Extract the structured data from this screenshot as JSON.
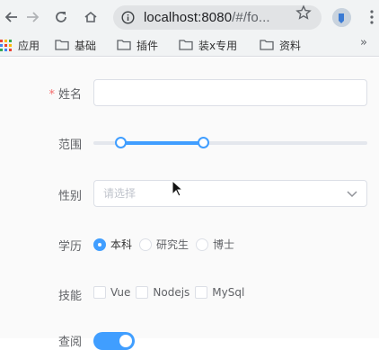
{
  "browser": {
    "url_host": "localhost:8080",
    "url_path": "/#/fo...",
    "bookmarks": [
      {
        "label": "应用",
        "icon": "apps-grid-icon"
      },
      {
        "label": "基础",
        "icon": "folder-icon"
      },
      {
        "label": "插件",
        "icon": "folder-icon"
      },
      {
        "label": "装x专用",
        "icon": "folder-icon"
      },
      {
        "label": "资料",
        "icon": "folder-icon"
      }
    ],
    "more_label": "»"
  },
  "form": {
    "name": {
      "label": "姓名",
      "required_mark": "*",
      "value": ""
    },
    "range": {
      "label": "范围",
      "min_fraction": 0.1,
      "max_fraction": 0.4
    },
    "gender": {
      "label": "性别",
      "placeholder": "请选择"
    },
    "education": {
      "label": "学历",
      "options": [
        "本科",
        "研究生",
        "博士"
      ],
      "selected": "本科"
    },
    "skills": {
      "label": "技能",
      "options": [
        "Vue",
        "Nodejs",
        "MySql"
      ]
    },
    "switch_row": {
      "label": "查阅",
      "on": true
    }
  },
  "colors": {
    "accent": "#409eff",
    "required": "#f56c6c"
  }
}
